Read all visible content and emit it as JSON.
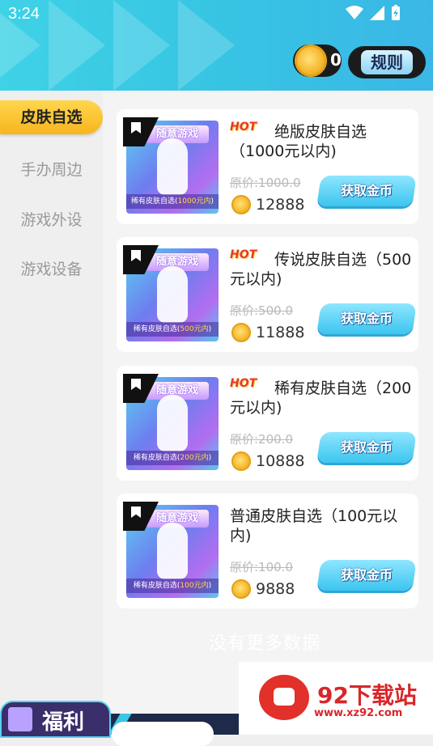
{
  "status_bar": {
    "time": "3:24"
  },
  "header": {
    "coins": "0",
    "rules_label": "规则"
  },
  "sidebar": {
    "items": [
      {
        "label": "皮肤自选",
        "active": true
      },
      {
        "label": "手办周边",
        "active": false
      },
      {
        "label": "游戏外设",
        "active": false
      },
      {
        "label": "游戏设备",
        "active": false
      }
    ]
  },
  "products": [
    {
      "hot": "HOT",
      "title": "绝版皮肤自选（1000元以内)",
      "thumb_logo": "随意游戏",
      "thumb_caption_pre": "稀有皮肤自选(",
      "thumb_caption_val": "1000元内",
      "thumb_caption_post": ")",
      "original_price": "原价:1000.0",
      "price": "12888",
      "button": "获取金币"
    },
    {
      "hot": "HOT",
      "title": "传说皮肤自选（500元以内)",
      "thumb_logo": "随意游戏",
      "thumb_caption_pre": "稀有皮肤自选(",
      "thumb_caption_val": "500元内",
      "thumb_caption_post": ")",
      "original_price": "原价:500.0",
      "price": "11888",
      "button": "获取金币"
    },
    {
      "hot": "HOT",
      "title": "稀有皮肤自选（200元以内)",
      "thumb_logo": "随意游戏",
      "thumb_caption_pre": "稀有皮肤自选(",
      "thumb_caption_val": "200元内",
      "thumb_caption_post": ")",
      "original_price": "原价:200.0",
      "price": "10888",
      "button": "获取金币"
    },
    {
      "hot": "",
      "title": "普通皮肤自选（100元以内)",
      "thumb_logo": "随意游戏",
      "thumb_caption_pre": "稀有皮肤自选(",
      "thumb_caption_val": "100元内",
      "thumb_caption_post": ")",
      "original_price": "原价:100.0",
      "price": "9888",
      "button": "获取金币"
    }
  ],
  "list_end_text": "没有更多数据",
  "bottom_tab": {
    "label": "福利"
  },
  "watermark": {
    "name": "92下载站",
    "url": "www.xz92.com"
  }
}
